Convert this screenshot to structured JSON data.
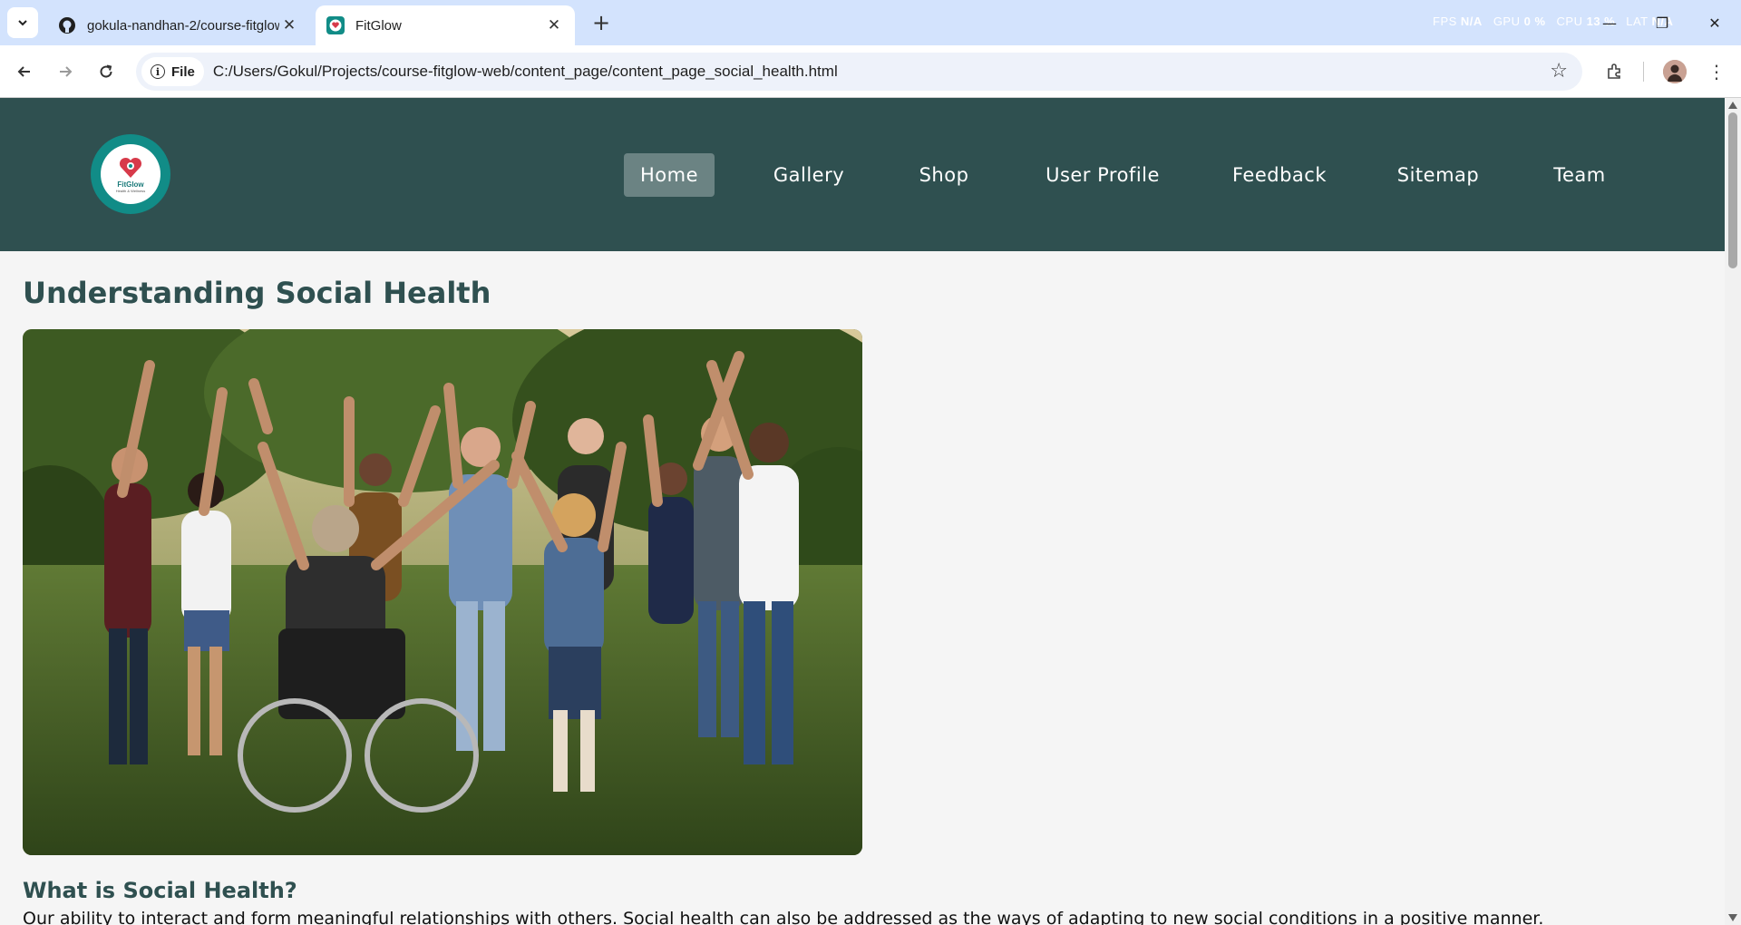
{
  "browser": {
    "tabs": [
      {
        "title": "gokula-nandhan-2/course-fitglow",
        "favicon": "github-icon",
        "active": false
      },
      {
        "title": "FitGlow",
        "favicon": "fitglow-icon",
        "active": true
      }
    ],
    "stats": {
      "fps_label": "FPS",
      "fps_value": "N/A",
      "gpu_label": "GPU",
      "gpu_value": "0 %",
      "cpu_label": "CPU",
      "cpu_value": "13 %",
      "lat_label": "LAT",
      "lat_value": "N/A"
    },
    "address": {
      "scheme_chip": "File",
      "url": "C:/Users/Gokul/Projects/course-fitglow-web/content_page/content_page_social_health.html"
    }
  },
  "site": {
    "logo": {
      "brand": "FitGlow",
      "tagline": "Health & Wellness"
    },
    "nav": [
      {
        "label": "Home",
        "active": true
      },
      {
        "label": "Gallery",
        "active": false
      },
      {
        "label": "Shop",
        "active": false
      },
      {
        "label": "User Profile",
        "active": false
      },
      {
        "label": "Feedback",
        "active": false
      },
      {
        "label": "Sitemap",
        "active": false
      },
      {
        "label": "Team",
        "active": false
      }
    ]
  },
  "main": {
    "title": "Understanding Social Health",
    "section_heading": "What is Social Health?",
    "section_body": "Our ability to interact and form meaningful relationships with others. Social health can also be addressed as the ways of adapting to new social conditions in a positive manner."
  },
  "colors": {
    "header_bg": "#2f5050",
    "nav_active_bg": "#6b8383",
    "heading": "#2f5050",
    "tabstrip": "#d3e3fd",
    "logo_ring": "#118c87"
  }
}
